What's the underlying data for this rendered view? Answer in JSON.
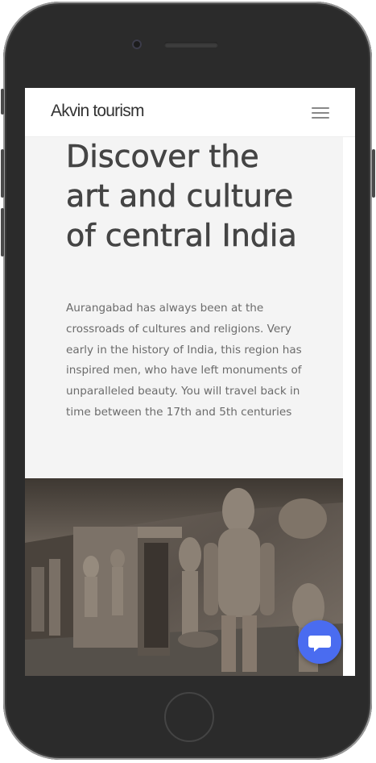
{
  "navbar": {
    "brand": "Akvin tourism",
    "menu_icon": "hamburger-menu-icon"
  },
  "hero": {
    "heading": "Discover the art and culture of central India",
    "description": "Aurangabad has always been at the crossroads of cultures and religions. Very early in the history of India, this region has inspired men, who have left monuments of unparalleled beauty. You will travel back in time between the 17th and 5th centuries"
  },
  "media": {
    "image_subject": "cave-temple-stone-carvings"
  },
  "chat": {
    "icon": "chat-bubble-icon",
    "accent": "#4a6cf0"
  },
  "colors": {
    "hero_background": "#f4f4f4",
    "heading": "#444444",
    "body_text": "#6b6b6b"
  }
}
